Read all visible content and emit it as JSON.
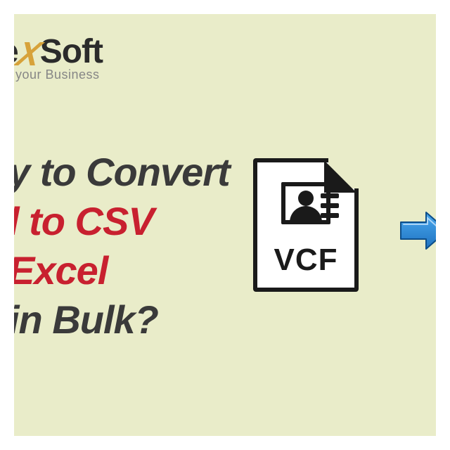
{
  "logo": {
    "line1_prefix": "e",
    "line1_mid": "X",
    "line1_suffix": "Soft",
    "tagline": "your Business"
  },
  "headline": {
    "l1": "y to Convert",
    "l2": "l to CSV Excel",
    "l3": "in Bulk?"
  },
  "icon": {
    "label": "VCF"
  }
}
